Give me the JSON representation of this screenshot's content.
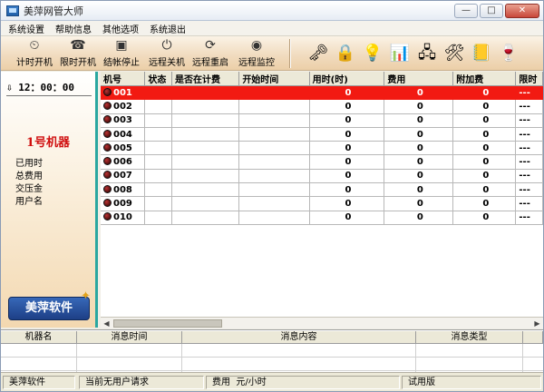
{
  "window": {
    "title": "美萍网管大师",
    "minimize": "—",
    "maximize": "□",
    "close": "✕"
  },
  "menu": [
    "系统设置",
    "帮助信息",
    "其他选项",
    "系统退出"
  ],
  "toolbar": {
    "buttons": [
      {
        "label": "计时开机",
        "icon": "clock-icon",
        "glyph": "⏲"
      },
      {
        "label": "限时开机",
        "icon": "alarm-icon",
        "glyph": "☎"
      },
      {
        "label": "结帐停止",
        "icon": "checkout-icon",
        "glyph": "▣"
      },
      {
        "label": "远程关机",
        "icon": "shutdown-icon",
        "glyph": "⏻"
      },
      {
        "label": "远程重启",
        "icon": "restart-icon",
        "glyph": "⟳"
      },
      {
        "label": "远程监控",
        "icon": "monitor-eye-icon",
        "glyph": "◉"
      }
    ],
    "icons": [
      {
        "name": "keys-icon",
        "glyph": "🗝"
      },
      {
        "name": "lock-icon",
        "glyph": "🔒"
      },
      {
        "name": "bulb-icon",
        "glyph": "💡"
      },
      {
        "name": "bar-chart-icon",
        "glyph": "📊"
      },
      {
        "name": "network-icon",
        "glyph": "🖧"
      },
      {
        "name": "tools-icon",
        "glyph": "🛠"
      },
      {
        "name": "notebook-icon",
        "glyph": "📒"
      },
      {
        "name": "drink-icon",
        "glyph": "🍷"
      }
    ]
  },
  "left_panel": {
    "time": "12：00：00",
    "machine": "1号机器",
    "labels": [
      "已用时",
      "总费用",
      "交压金",
      "用户名"
    ],
    "logo": "美萍软件"
  },
  "grid": {
    "columns": [
      "机号",
      "状态",
      "是否在计费",
      "开始时间",
      "用时(时)",
      "费用",
      "附加费",
      "限时"
    ],
    "rows": [
      {
        "id": "001",
        "status": "",
        "billing": "",
        "start": "",
        "hours": "0",
        "fee": "0",
        "extra": "0",
        "limit": "---"
      },
      {
        "id": "002",
        "status": "",
        "billing": "",
        "start": "",
        "hours": "0",
        "fee": "0",
        "extra": "0",
        "limit": "---"
      },
      {
        "id": "003",
        "status": "",
        "billing": "",
        "start": "",
        "hours": "0",
        "fee": "0",
        "extra": "0",
        "limit": "---"
      },
      {
        "id": "004",
        "status": "",
        "billing": "",
        "start": "",
        "hours": "0",
        "fee": "0",
        "extra": "0",
        "limit": "---"
      },
      {
        "id": "005",
        "status": "",
        "billing": "",
        "start": "",
        "hours": "0",
        "fee": "0",
        "extra": "0",
        "limit": "---"
      },
      {
        "id": "006",
        "status": "",
        "billing": "",
        "start": "",
        "hours": "0",
        "fee": "0",
        "extra": "0",
        "limit": "---"
      },
      {
        "id": "007",
        "status": "",
        "billing": "",
        "start": "",
        "hours": "0",
        "fee": "0",
        "extra": "0",
        "limit": "---"
      },
      {
        "id": "008",
        "status": "",
        "billing": "",
        "start": "",
        "hours": "0",
        "fee": "0",
        "extra": "0",
        "limit": "---"
      },
      {
        "id": "009",
        "status": "",
        "billing": "",
        "start": "",
        "hours": "0",
        "fee": "0",
        "extra": "0",
        "limit": "---"
      },
      {
        "id": "010",
        "status": "",
        "billing": "",
        "start": "",
        "hours": "0",
        "fee": "0",
        "extra": "0",
        "limit": "---"
      }
    ],
    "selected_row": 0
  },
  "messages": {
    "columns": [
      "机器名",
      "消息时间",
      "消息内容",
      "消息类型"
    ]
  },
  "status": {
    "company": "美萍软件",
    "requests": "当前无用户请求",
    "fee_label": "费用",
    "fee_value": "元/小时",
    "edition": "试用版"
  },
  "colors": {
    "selected_row": "#f21a12",
    "accent": "#2aa7a0",
    "machine_label": "#d01010"
  }
}
